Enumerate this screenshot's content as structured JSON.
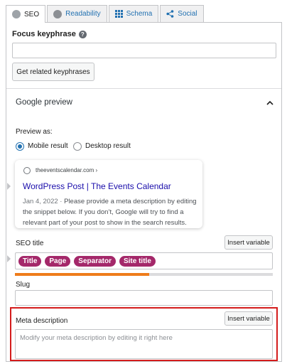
{
  "tabs": [
    {
      "label": "SEO",
      "icon": "seo-dot-icon",
      "active": true
    },
    {
      "label": "Readability",
      "icon": "readability-dot-icon",
      "active": false
    },
    {
      "label": "Schema",
      "icon": "schema-grid-icon",
      "active": false
    },
    {
      "label": "Social",
      "icon": "share-icon",
      "active": false
    }
  ],
  "focus_keyphrase": {
    "label": "Focus keyphrase",
    "help": "?",
    "value": "",
    "related_button": "Get related keyphrases"
  },
  "google_preview": {
    "heading": "Google preview",
    "preview_as": "Preview as:",
    "options": [
      "Mobile result",
      "Desktop result"
    ],
    "selected": "Mobile result",
    "snippet": {
      "url": "theeventscalendar.com ›",
      "title": "WordPress Post | The Events Calendar",
      "date": "Jan 4, 2022",
      "separator": " · ",
      "description": "Please provide a meta description by editing the snippet below. If you don’t, Google will try to find a relevant part of your post to show in the search results."
    }
  },
  "seo_title": {
    "label": "SEO title",
    "insert_button": "Insert variable",
    "chips": [
      "Title",
      "Page",
      "Separator",
      "Site title"
    ],
    "progress": 0.52
  },
  "slug": {
    "label": "Slug",
    "value": ""
  },
  "meta_description": {
    "label": "Meta description",
    "insert_button": "Insert variable",
    "placeholder": "Modify your meta description by editing it right here"
  },
  "colors": {
    "chip": "#a4286a",
    "progress": "#ee7c1b",
    "link": "#2271b1",
    "highlight": "#d41c1c"
  }
}
